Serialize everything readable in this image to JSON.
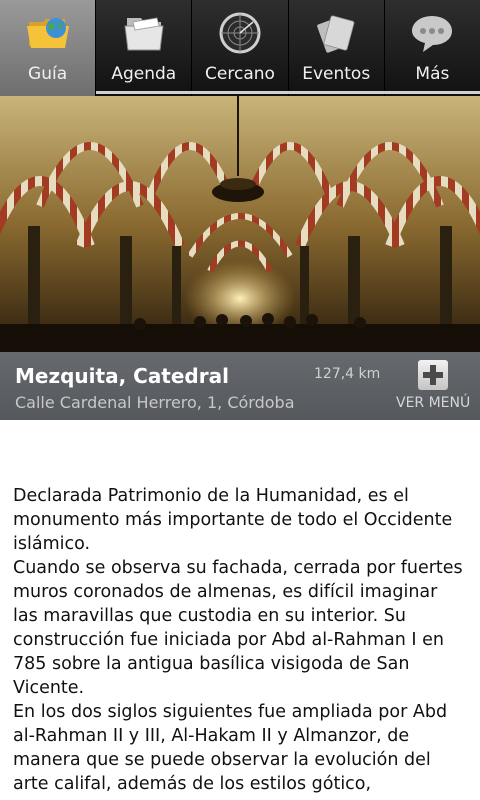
{
  "tabs": [
    {
      "label": "Guía",
      "icon": "folder-globe-icon",
      "active": true
    },
    {
      "label": "Agenda",
      "icon": "folder-icon",
      "active": false
    },
    {
      "label": "Cercano",
      "icon": "radar-icon",
      "active": false
    },
    {
      "label": "Eventos",
      "icon": "ticket-icon",
      "active": false
    },
    {
      "label": "Más",
      "icon": "speech-bubble-icon",
      "active": false
    }
  ],
  "place": {
    "title": "Mezquita, Catedral",
    "address": "Calle Cardenal Herrero, 1, Córdoba",
    "distance": "127,4 km",
    "menu_label": "VER MENÚ"
  },
  "description": [
    "Declarada Patrimonio de la Humanidad, es el monumento más importante de todo el Occidente islámico.",
    "Cuando se observa su fachada, cerrada por fuertes muros coronados de almenas, es difícil imaginar las maravillas que custodia en su interior. Su construcción fue iniciada por Abd al-Rahman I en 785 sobre la antigua basílica visigoda de San Vicente.",
    "En los dos siglos siguientes fue ampliada por Abd al-Rahman II y III, Al-Hakam II y Almanzor, de manera que se puede observar la evolución del arte califal, además de los estilos gótico,"
  ],
  "colors": {
    "accent_tab": "#8a8a8a",
    "infobar": "#5e6164"
  }
}
